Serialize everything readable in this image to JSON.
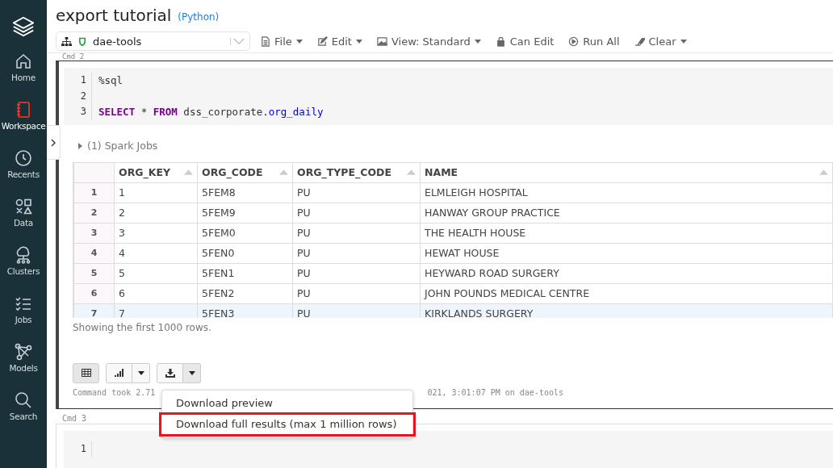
{
  "sidebar": {
    "items": [
      {
        "label": "Home",
        "selected": false
      },
      {
        "label": "Workspace",
        "selected": true
      },
      {
        "label": "Recents",
        "selected": false
      },
      {
        "label": "Data",
        "selected": false
      },
      {
        "label": "Clusters",
        "selected": false
      },
      {
        "label": "Jobs",
        "selected": false
      },
      {
        "label": "Models",
        "selected": false
      },
      {
        "label": "Search",
        "selected": false
      }
    ]
  },
  "notebook": {
    "title": "export tutorial",
    "language": "(Python)"
  },
  "toolbar": {
    "cluster": "dae-tools",
    "menus": [
      {
        "label": "File",
        "dropdown": true
      },
      {
        "label": "Edit",
        "dropdown": true
      },
      {
        "label": "View: Standard",
        "dropdown": true
      },
      {
        "label": "Can Edit",
        "dropdown": false
      },
      {
        "label": "Run All",
        "dropdown": false
      },
      {
        "label": "Clear",
        "dropdown": true
      }
    ]
  },
  "cells": [
    {
      "label": "Cmd 2",
      "code_lines": [
        {
          "number": "1",
          "tokens": [
            {
              "text": "%sql",
              "kind": "plain"
            }
          ]
        },
        {
          "number": "2"
        },
        {
          "number": "3",
          "tokens": [
            {
              "text": "SELECT",
              "kind": "keyword"
            },
            {
              "text": " * ",
              "kind": "plain"
            },
            {
              "text": "FROM",
              "kind": "keyword"
            },
            {
              "text": " dss_corporate",
              "kind": "plain"
            },
            {
              "text": ".org_daily",
              "kind": "property"
            }
          ]
        }
      ],
      "spark_jobs": "(1) Spark Jobs",
      "table": {
        "columns": [
          "ORG_KEY",
          "ORG_CODE",
          "ORG_TYPE_CODE",
          "NAME"
        ],
        "rows": [
          {
            "number": "1",
            "cells": [
              "1",
              "5FEM8",
              "PU",
              "ELMLEIGH HOSPITAL"
            ],
            "selected": false
          },
          {
            "number": "2",
            "cells": [
              "2",
              "5FEM9",
              "PU",
              "HANWAY GROUP PRACTICE"
            ],
            "selected": false
          },
          {
            "number": "3",
            "cells": [
              "3",
              "5FEM0",
              "PU",
              "THE HEALTH HOUSE"
            ],
            "selected": false
          },
          {
            "number": "4",
            "cells": [
              "4",
              "5FEN0",
              "PU",
              "HEWAT HOUSE"
            ],
            "selected": false
          },
          {
            "number": "5",
            "cells": [
              "5",
              "5FEN1",
              "PU",
              "HEYWARD ROAD SURGERY"
            ],
            "selected": false
          },
          {
            "number": "6",
            "cells": [
              "6",
              "5FEN2",
              "PU",
              "JOHN POUNDS MEDICAL CENTRE"
            ],
            "selected": false
          },
          {
            "number": "7",
            "cells": [
              "7",
              "5FEN3",
              "PU",
              "KIRKLANDS SURGERY"
            ],
            "selected": true
          }
        ]
      },
      "row_note": "Showing the first 1000 rows.",
      "view_table_selected": true,
      "command_info": [
        "Command took 2.71",
        "021, 3:01:07 PM on dae-tools"
      ]
    },
    {
      "label": "Cmd 3",
      "code_lines": [
        {
          "number": "1"
        }
      ]
    }
  ],
  "download_menu": {
    "items": [
      {
        "label": "Download preview",
        "highlighted": false
      },
      {
        "label": "Download full results (max 1 million rows)",
        "highlighted": true
      }
    ]
  }
}
